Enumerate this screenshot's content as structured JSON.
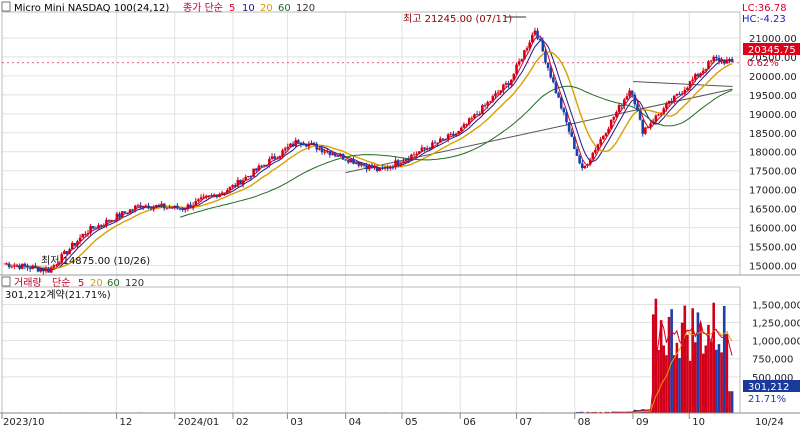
{
  "chart_data": {
    "type": "candlestick",
    "title": "Micro Mini NASDAQ 100(24,12)",
    "legend_prefix": "종가 단순",
    "ma_periods": [
      "5",
      "10",
      "20",
      "60",
      "120"
    ],
    "ma_colors": [
      "#d4002a",
      "#1a1a8c",
      "#d8a000",
      "#1f6b1f",
      "#333333"
    ],
    "lc_text": "LC:36.78",
    "hc_text": "HC:-4.23",
    "price_axis": {
      "ticks": [
        15000,
        15500,
        16000,
        16500,
        17000,
        17500,
        18000,
        18500,
        19000,
        19500,
        20000,
        20500,
        21000
      ],
      "tick_labels": [
        "15000.00",
        "15500.00",
        "16000.00",
        "16500.00",
        "17000.00",
        "17500.00",
        "18000.00",
        "18500.00",
        "19000.00",
        "19500.00",
        "20000.00",
        "20500.00",
        "21000.00"
      ],
      "ylim": [
        14750,
        21500
      ]
    },
    "current_price": 20345.75,
    "current_price_label": "20345.75",
    "change_label": "0.62%",
    "high_annotation": "최고 21245.00 (07/11)",
    "low_annotation": "최저 14875.00 (10/26)",
    "months": [
      "2023/10",
      "12",
      "2024/01",
      "02",
      "03",
      "04",
      "05",
      "06",
      "07",
      "08",
      "09",
      "10",
      "10/24"
    ],
    "key_prices": [
      {
        "date": "2023/10/02",
        "price": 15050
      },
      {
        "date": "2023/10/26",
        "price": 14875
      },
      {
        "date": "2023/11/15",
        "price": 15900
      },
      {
        "date": "2023/12/14",
        "price": 16600
      },
      {
        "date": "2024/01/05",
        "price": 16500
      },
      {
        "date": "2024/01/31",
        "price": 17050
      },
      {
        "date": "2024/03/07",
        "price": 18300
      },
      {
        "date": "2024/04/19",
        "price": 17500
      },
      {
        "date": "2024/05/31",
        "price": 18500
      },
      {
        "date": "2024/06/28",
        "price": 19900
      },
      {
        "date": "2024/07/11",
        "price": 21245
      },
      {
        "date": "2024/08/05",
        "price": 17500
      },
      {
        "date": "2024/08/31",
        "price": 19700
      },
      {
        "date": "2024/09/06",
        "price": 18550
      },
      {
        "date": "2024/10/14",
        "price": 20450
      },
      {
        "date": "2024/10/24",
        "price": 20345
      }
    ],
    "volume": {
      "title": "거래량",
      "legend_prefix": "단순",
      "ma_periods": [
        "5",
        "20",
        "60",
        "120"
      ],
      "summary_label": "301,212계약(21.71%)",
      "ticks": [
        500000,
        750000,
        1000000,
        1250000,
        1500000
      ],
      "tick_labels": [
        "500,000",
        "750,000",
        "1,000,000",
        "1,250,000",
        "1,500,000"
      ],
      "ylim": [
        0,
        1700000
      ],
      "current_label": "301,212",
      "current_pct_label": "21.71%",
      "current_value": 301212,
      "peak_value": 1650000
    }
  }
}
